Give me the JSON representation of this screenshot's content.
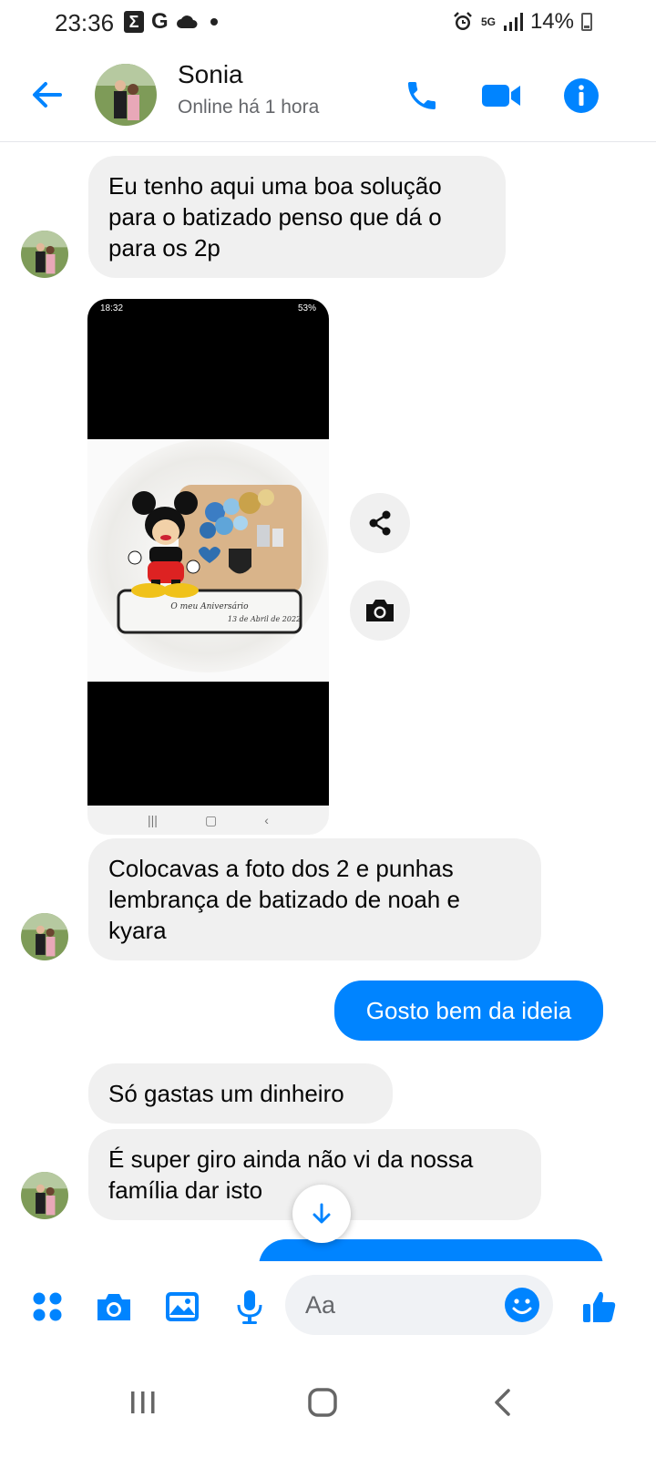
{
  "status_bar": {
    "time": "23:36",
    "g_label": "G",
    "network": "5G",
    "battery": "14%"
  },
  "header": {
    "contact_name": "Sonia",
    "contact_status": "Online há 1 hora"
  },
  "messages": [
    {
      "side": "in",
      "text": "Eu tenho aqui uma boa solução para o batizado penso que  dá o para os 2p"
    },
    {
      "side": "in",
      "type": "image"
    },
    {
      "side": "in",
      "text": "Colocavas a foto dos 2 e punhas lembrança de batizado de noah e kyara"
    },
    {
      "side": "out",
      "text": "Gosto bem da ideia"
    },
    {
      "side": "in",
      "text": "Só gastas um dinheiro"
    },
    {
      "side": "in",
      "text": "É super giro ainda não vi da nossa família dar isto"
    }
  ],
  "shared_image": {
    "status_time": "18:32",
    "status_batt": "53%",
    "plaque_text_1": "O meu Aniversário",
    "plaque_text_2": "13 de Abril de 2022"
  },
  "composer": {
    "placeholder": "Aa"
  },
  "colors": {
    "accent": "#0084ff",
    "incoming_bubble": "#f0f0f0"
  }
}
